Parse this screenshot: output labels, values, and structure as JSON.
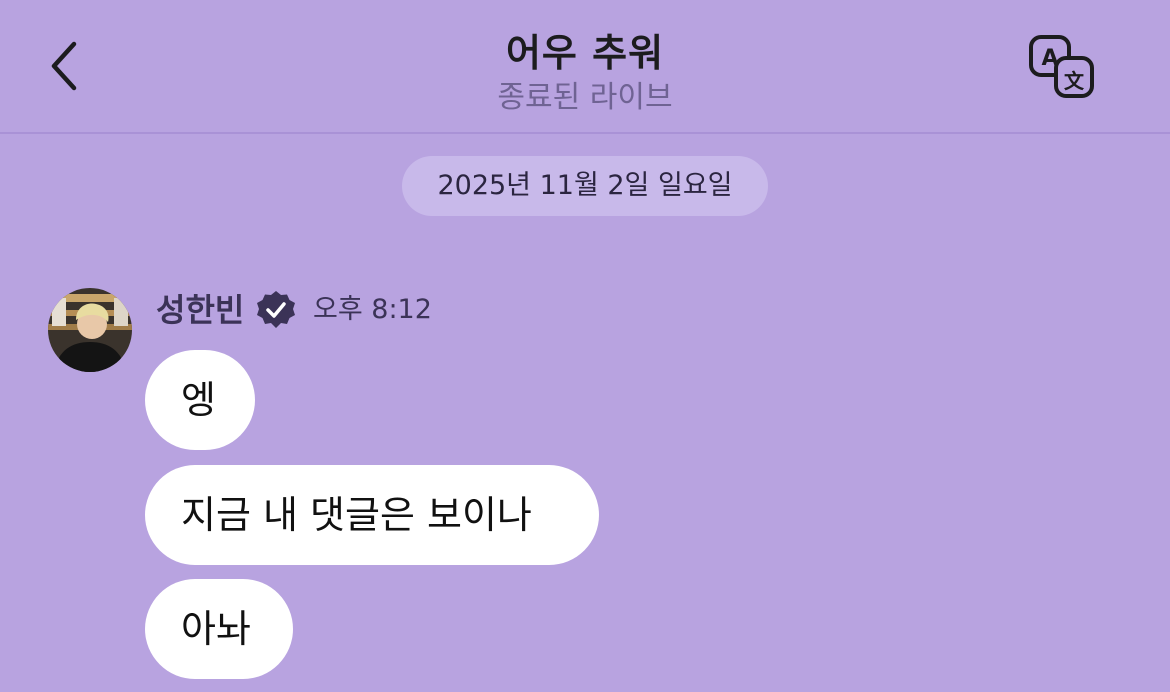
{
  "header": {
    "title": "어우 추워",
    "subtitle": "종료된 라이브",
    "back_icon": "chevron-left-icon",
    "translate_icon": "translate-icon"
  },
  "chat": {
    "date_separator": "2025년 11월 2일 일요일",
    "message_group": {
      "sender_name": "성한빈",
      "verified": true,
      "time": "오후 8:12",
      "messages": [
        "엥",
        "지금 내 댓글은 보이나",
        "아놔"
      ]
    }
  },
  "colors": {
    "background": "#b8a3e0",
    "bubble": "#ffffff",
    "date_pill": "#c8b9ea",
    "verified_badge": "#3b3357"
  }
}
